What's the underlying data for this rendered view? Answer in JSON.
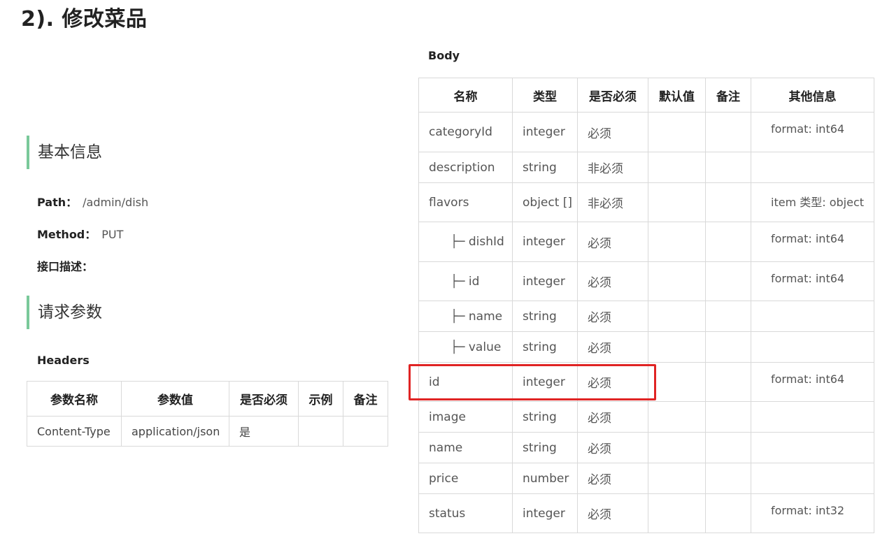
{
  "title": "2). 修改菜品",
  "basic_section": "基本信息",
  "path": {
    "label": "Path：",
    "value": "/admin/dish"
  },
  "method": {
    "label": "Method：",
    "value": "PUT"
  },
  "desc": {
    "label": "接口描述："
  },
  "request_section": "请求参数",
  "headers": {
    "title": "Headers",
    "columns": [
      "参数名称",
      "参数值",
      "是否必须",
      "示例",
      "备注"
    ],
    "rows": [
      [
        "Content-Type",
        "application/json",
        "是",
        "",
        ""
      ]
    ]
  },
  "body": {
    "title": "Body",
    "columns": [
      "名称",
      "类型",
      "是否必须",
      "默认值",
      "备注",
      "其他信息"
    ],
    "rows": [
      {
        "name": "categoryId",
        "type": "integer",
        "required": "必须",
        "info": "format: int64"
      },
      {
        "name": "description",
        "type": "string",
        "required": "非必须",
        "info": ""
      },
      {
        "name": "flavors",
        "type": "object []",
        "required": "非必须",
        "info": "item 类型: object"
      },
      {
        "name": "├─ dishId",
        "type": "integer",
        "required": "必须",
        "info": "format: int64"
      },
      {
        "name": "├─ id",
        "type": "integer",
        "required": "必须",
        "info": "format: int64"
      },
      {
        "name": "├─ name",
        "type": "string",
        "required": "必须",
        "info": ""
      },
      {
        "name": "├─ value",
        "type": "string",
        "required": "必须",
        "info": ""
      },
      {
        "name": "id",
        "type": "integer",
        "required": "必须",
        "info": "format: int64"
      },
      {
        "name": "image",
        "type": "string",
        "required": "必须",
        "info": ""
      },
      {
        "name": "name",
        "type": "string",
        "required": "必须",
        "info": ""
      },
      {
        "name": "price",
        "type": "number",
        "required": "必须",
        "info": ""
      },
      {
        "name": "status",
        "type": "integer",
        "required": "必须",
        "info": "format: int32"
      }
    ]
  },
  "colors": {
    "section_bar": "#7ac99a",
    "highlight": "#e02424"
  }
}
